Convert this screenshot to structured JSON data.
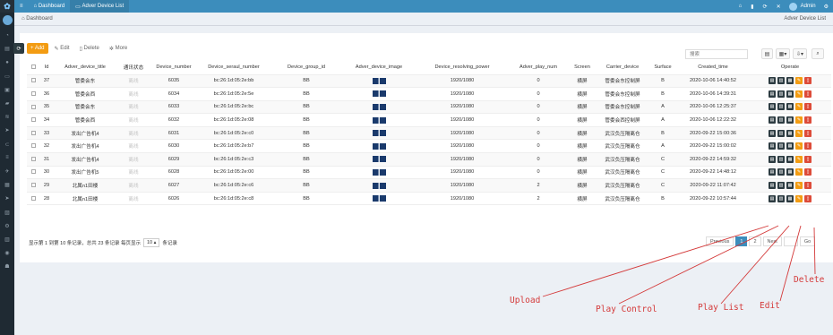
{
  "topbar": {
    "menu_icon": "menu-icon",
    "tabs": [
      {
        "label": "Dashboard"
      },
      {
        "label": "Adver Device List"
      }
    ],
    "user": "Admin"
  },
  "breadcrumb": {
    "left": "Dashboard",
    "right": "Adver Device List"
  },
  "toolbar": {
    "add": "+ Add",
    "edit": "Edit",
    "delete": "Delete",
    "more": "More"
  },
  "search": {
    "placeholder": "搜索"
  },
  "table": {
    "headers": [
      "Id",
      "Adver_device_title",
      "通讯状态",
      "Device_number",
      "Device_seraul_number",
      "Device_group_id",
      "Adver_device_image",
      "Device_resolving_power",
      "Adver_play_num",
      "Screen",
      "Carrier_device",
      "Surface",
      "Created_time",
      "Operate"
    ],
    "rows": [
      {
        "id": "37",
        "title": "管委会东",
        "status": "离线",
        "number": "6035",
        "serial": "bc:26:1d:05:2e:bb",
        "group": "BB",
        "res": "1920/1080",
        "play": "0",
        "screen": "横屏",
        "carrier": "管委会东控制屏",
        "surface": "B",
        "created": "2020-10-06 14:40:52"
      },
      {
        "id": "36",
        "title": "管委会西",
        "status": "离线",
        "number": "6034",
        "serial": "bc:26:1d:05:2e:5e",
        "group": "BB",
        "res": "1920/1080",
        "play": "0",
        "screen": "横屏",
        "carrier": "管委会东控制屏",
        "surface": "B",
        "created": "2020-10-06 14:39:31"
      },
      {
        "id": "35",
        "title": "管委会东",
        "status": "离线",
        "number": "6033",
        "serial": "bc:26:1d:05:2e:bc",
        "group": "BB",
        "res": "1920/1080",
        "play": "0",
        "screen": "横屏",
        "carrier": "管委会东控制屏",
        "surface": "A",
        "created": "2020-10-06 12:25:37"
      },
      {
        "id": "34",
        "title": "管委会西",
        "status": "离线",
        "number": "6032",
        "serial": "bc:26:1d:05:2e:08",
        "group": "BB",
        "res": "1920/1080",
        "play": "0",
        "screen": "横屏",
        "carrier": "管委会西控制屏",
        "surface": "A",
        "created": "2020-10-06 12:22:32"
      },
      {
        "id": "33",
        "title": "发出广告机4",
        "status": "离线",
        "number": "6031",
        "serial": "bc:26:1d:05:2e:c0",
        "group": "BB",
        "res": "1920/1080",
        "play": "0",
        "screen": "横屏",
        "carrier": "武汉负压隔离仓",
        "surface": "B",
        "created": "2020-09-22 15:00:36"
      },
      {
        "id": "32",
        "title": "发出广告机4",
        "status": "离线",
        "number": "6030",
        "serial": "bc:26:1d:05:2e:b7",
        "group": "BB",
        "res": "1920/1080",
        "play": "0",
        "screen": "横屏",
        "carrier": "武汉负压隔离仓",
        "surface": "A",
        "created": "2020-09-22 15:00:02"
      },
      {
        "id": "31",
        "title": "发出广告机4",
        "status": "离线",
        "number": "6029",
        "serial": "bc:26:1d:05:2e:c3",
        "group": "BB",
        "res": "1920/1080",
        "play": "0",
        "screen": "横屏",
        "carrier": "武汉负压隔离仓",
        "surface": "C",
        "created": "2020-09-22 14:59:32"
      },
      {
        "id": "30",
        "title": "发出广告机5",
        "status": "离线",
        "number": "6028",
        "serial": "bc:26:1d:05:2e:00",
        "group": "BB",
        "res": "1920/1080",
        "play": "0",
        "screen": "横屏",
        "carrier": "武汉负压隔离仓",
        "surface": "C",
        "created": "2020-09-22 14:48:12"
      },
      {
        "id": "29",
        "title": "北属n1田楼",
        "status": "离线",
        "number": "6027",
        "serial": "bc:26:1d:05:2e:c6",
        "group": "BB",
        "res": "1920/1080",
        "play": "2",
        "screen": "横屏",
        "carrier": "武汉负压隔离仓",
        "surface": "C",
        "created": "2020-09-22 11:07:42"
      },
      {
        "id": "28",
        "title": "北属n1田楼",
        "status": "离线",
        "number": "6026",
        "serial": "bc:26:1d:05:2e:c8",
        "group": "BB",
        "res": "1920/1080",
        "play": "2",
        "screen": "横屏",
        "carrier": "武汉负压隔离仓",
        "surface": "B",
        "created": "2020-09-22 10:57:44"
      }
    ]
  },
  "footer": {
    "summary": "显示第 1 到第 10 条记录，总共 23 条记录 每页显示",
    "per_page": "10 ▴",
    "suffix": "条记录"
  },
  "pager": {
    "previous": "Previous",
    "pages": [
      "1",
      "2"
    ],
    "next": "Next",
    "go": "Go"
  },
  "annotations": {
    "upload": "Upload",
    "play_control": "Play Control",
    "play_list": "Play List",
    "edit": "Edit",
    "delete": "Delete"
  },
  "colors": {
    "primary": "#3c8dbc",
    "sidebar": "#1f2a33",
    "warning": "#f39c12",
    "danger": "#dd4b39",
    "annotation": "#d43a3a"
  }
}
